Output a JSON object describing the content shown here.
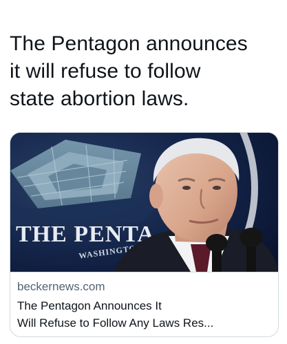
{
  "tweet": {
    "text": "The Pentagon announces\nit will refuse to follow\nstate abortion laws."
  },
  "link_card": {
    "domain": "beckernews.com",
    "title_line_1": "The Pentagon Announces It",
    "title_line_2": "Will Refuse to Follow Any Laws Res...",
    "image": {
      "seal_text": "THE PENTA",
      "seal_subtext": "WASHINGTON"
    }
  }
}
